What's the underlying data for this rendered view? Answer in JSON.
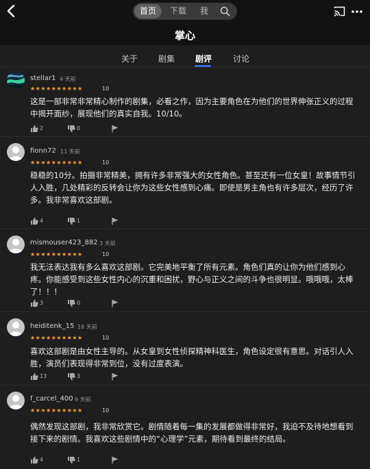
{
  "nav": {
    "pill": {
      "home": "首页",
      "download": "下载",
      "me": "我"
    },
    "icons": {
      "back": "back-chevron-icon",
      "search": "search-icon",
      "cast": "cast-icon",
      "more": "more-dots-icon"
    }
  },
  "page": {
    "title": "掌心"
  },
  "tabs": [
    "关于",
    "剧集",
    "剧评",
    "讨论"
  ],
  "active_tab": "剧评",
  "colors": {
    "accent": "#2f6fe0",
    "star": "#ffa614",
    "background": "#1e1e1e"
  },
  "reviews": [
    {
      "user": "stellar1",
      "time": "4 天前",
      "stars": "★★★★★★★★★★",
      "score": "10",
      "text": "这是一部非常非常精心制作的剧集，必看之作，因为主要角色在为他们的世界伸张正义的过程中揭开面纱，展现他们的真实自我。10/10。",
      "likes": "2",
      "dislikes": "0"
    },
    {
      "user": "fionn72",
      "time": "11 天前",
      "stars": "★★★★★★★★★★",
      "score": "10",
      "text": "稳稳的10分。拍摄非常精美，拥有许多非常强大的女性角色。甚至还有一位女皇！故事情节引人入胜，几处精彩的反转会让你为这些女性感到心痛。即使是男主角也有许多层次，经历了许多。我非常喜欢这部剧。",
      "likes": "4",
      "dislikes": "1"
    },
    {
      "user": "mismouser423_882",
      "time": "3 天前",
      "stars": "★★★★★★★★★★",
      "score": "10",
      "text": "我无法表达我有多么喜欢这部剧。它完美地平衡了所有元素。角色们真的让你为他们感到心疼。你能感受到这些女性内心的沉重和困扰，野心与正义之间的斗争也很明显。哦哦哦，太棒了！！！",
      "likes": "3",
      "dislikes": "0"
    },
    {
      "user": "heiditenk_15",
      "time": "16 天前",
      "stars": "★★★★★★★★★★",
      "score": "10",
      "text": "喜欢这部剧是由女性主导的。从女皇到女性侦探精神科医生，角色设定很有意思。对话引人入胜，演员们表现得非常到位，没有过度表演。",
      "likes": "13",
      "dislikes": "3"
    },
    {
      "user": "f_carcel_400",
      "time": "9 天前",
      "stars": "★★★★★★★★★★",
      "score": "10",
      "text": "偶然发现这部剧，我非常欣赏它。剧情随着每一集的发展都做得非常好，我迫不及待地想看到接下来的剧情。我喜欢这些剧情中的“心理学”元素，期待看到最终的结局。",
      "likes": "4",
      "dislikes": "1"
    }
  ]
}
